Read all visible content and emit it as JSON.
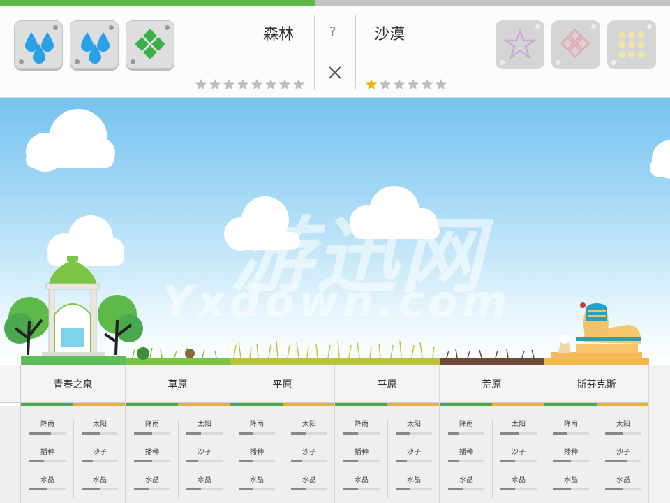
{
  "progress": {
    "fraction": 0.47
  },
  "header": {
    "left_tools": [
      {
        "icon": "two-drops-icon"
      },
      {
        "icon": "two-drops-icon"
      },
      {
        "icon": "green-diamond-icon"
      }
    ],
    "right_tools": [
      {
        "icon": "star-outline-icon"
      },
      {
        "icon": "pink-diamond-icon"
      },
      {
        "icon": "dot-grid-icon"
      }
    ],
    "left_biome": {
      "name": "森林",
      "stars_filled": 0,
      "stars_total": 8
    },
    "right_biome": {
      "name": "沙漠",
      "stars_filled": 1,
      "stars_total": 6
    },
    "help_label": "?",
    "colors": {
      "drop": "#2aa0e6",
      "green": "#3ab04a",
      "gold": "#f4b400"
    }
  },
  "watermark": {
    "line1": "游迅网",
    "line2": "Yxdown.com"
  },
  "stat_labels": {
    "rain": "降雨",
    "sun": "太阳",
    "seed": "播种",
    "sand": "沙子",
    "crystal": "水晶"
  },
  "biomes": [
    {
      "name": "青春之泉",
      "rain": 0.6,
      "sun": 0.5,
      "seed": 0.4,
      "sand": 0.3,
      "crystal_l": 0.5,
      "crystal_r": 0.5
    },
    {
      "name": "草原",
      "rain": 0.5,
      "sun": 0.4,
      "seed": 0.5,
      "sand": 0.3,
      "crystal_l": 0.4,
      "crystal_r": 0.4
    },
    {
      "name": "平原",
      "rain": 0.4,
      "sun": 0.4,
      "seed": 0.4,
      "sand": 0.3,
      "crystal_l": 0.4,
      "crystal_r": 0.4
    },
    {
      "name": "平原",
      "rain": 0.4,
      "sun": 0.4,
      "seed": 0.4,
      "sand": 0.3,
      "crystal_l": 0.4,
      "crystal_r": 0.4
    },
    {
      "name": "荒原",
      "rain": 0.3,
      "sun": 0.5,
      "seed": 0.3,
      "sand": 0.4,
      "crystal_l": 0.4,
      "crystal_r": 0.4
    },
    {
      "name": "斯芬克斯",
      "rain": 0.4,
      "sun": 0.5,
      "seed": 0.5,
      "sand": 0.6,
      "crystal_l": 0.5,
      "crystal_r": 0.5
    }
  ]
}
